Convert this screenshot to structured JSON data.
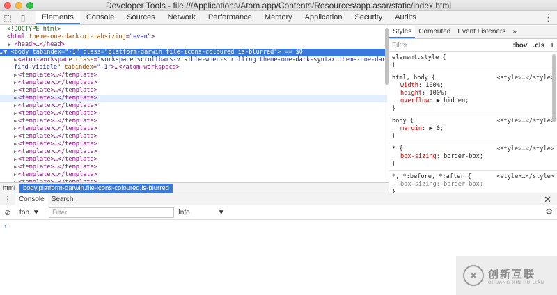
{
  "window": {
    "title": "Developer Tools - file:///Applications/Atom.app/Contents/Resources/app.asar/static/index.html"
  },
  "main_tabs": [
    "Elements",
    "Console",
    "Sources",
    "Network",
    "Performance",
    "Memory",
    "Application",
    "Security",
    "Audits"
  ],
  "dom": {
    "doctype": "<!DOCTYPE html>",
    "html_open": {
      "tag": "<html",
      "attr": "theme-one-dark-ui-tabsizing",
      "val": "\"even\"",
      "close": ">"
    },
    "head": "<head>…</head>",
    "body_line": {
      "prefix": "…▼",
      "tag": "<body",
      "a1": "tabindex",
      "v1": "\"-1\"",
      "a2": "class",
      "v2": "\"platform-darwin file-icons-coloured is-blurred\"",
      "close": ">",
      "eq": "== $0"
    },
    "workspace_line1": {
      "tag": "<atom-workspace",
      "a1": "class",
      "v1": "\"workspace scrollbars-visible-when-scrolling theme-one-dark-syntax theme-one-dark-ui"
    },
    "workspace_line2": {
      "v1": "find-visible\"",
      "a2": "tabindex",
      "v2": "\"-1\"",
      "rest": ">…</atom-workspace>"
    },
    "template": "<template>…</template>"
  },
  "breadcrumb": {
    "html": "html",
    "body": "body.platform-darwin.file-icons-coloured.is-blurred"
  },
  "styles": {
    "tabs": [
      "Styles",
      "Computed",
      "Event Listeners",
      "»"
    ],
    "filter_placeholder": "Filter",
    "hov": ":hov",
    "cls": ".cls",
    "plus": "+",
    "rules": [
      {
        "selector": "element.style {",
        "source": "",
        "props": []
      },
      {
        "selector": "html, body {",
        "source": "<style>…</style>",
        "props": [
          [
            "width",
            "100%;"
          ],
          [
            "height",
            "100%;"
          ],
          [
            "overflow",
            "▶ hidden;"
          ]
        ]
      },
      {
        "selector": "body {",
        "source": "<style>…</style>",
        "props": [
          [
            "margin",
            "▶ 0;"
          ]
        ]
      },
      {
        "selector": "* {",
        "source": "<style>…</style>",
        "props": [
          [
            "box-sizing",
            "border-box;"
          ]
        ]
      },
      {
        "selector": "*, *:before, *:after {",
        "source": "<style>…</style>",
        "props": [
          [
            "box-sizing",
            "border-box;"
          ]
        ],
        "strike": true
      }
    ],
    "close_brace": "}"
  },
  "drawer": {
    "tabs": [
      "Console",
      "Search"
    ],
    "context": "top",
    "filter_placeholder": "Filter",
    "level": "Info",
    "prompt": "›"
  },
  "watermark": {
    "logo": "✕",
    "cn": "创新互联",
    "en": "CHUANG XIN HU LIAN"
  }
}
